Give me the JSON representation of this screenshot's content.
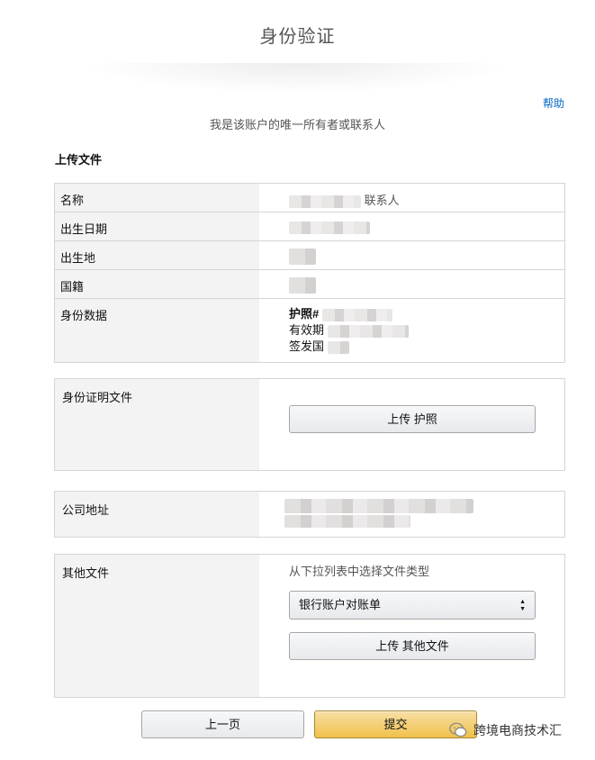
{
  "page": {
    "title": "身份验证",
    "help": "帮助",
    "subtitle": "我是该账户的唯一所有者或联系人",
    "upload_heading": "上传文件"
  },
  "info_rows": {
    "name_label": "名称",
    "name_suffix": "联系人",
    "dob_label": "出生日期",
    "birthplace_label": "出生地",
    "nationality_label": "国籍",
    "id_label": "身份数据",
    "passport_prefix": "护照#",
    "expiry_prefix": "有效期",
    "issuer_prefix": "签发国"
  },
  "id_proof": {
    "label": "身份证明文件",
    "upload_button": "上传 护照"
  },
  "company_address": {
    "label": "公司地址"
  },
  "other_docs": {
    "label": "其他文件",
    "hint": "从下拉列表中选择文件类型",
    "selected_option": "银行账户对账单",
    "upload_button": "上传 其他文件"
  },
  "footer": {
    "prev_button": "上一页",
    "submit_button": "提交"
  },
  "watermark": {
    "text": "跨境电商技术汇"
  },
  "colors": {
    "primary_button": "#f0c14b",
    "link": "#0066c0",
    "label_bg": "#f3f3f3",
    "border": "#d5d5d5"
  }
}
